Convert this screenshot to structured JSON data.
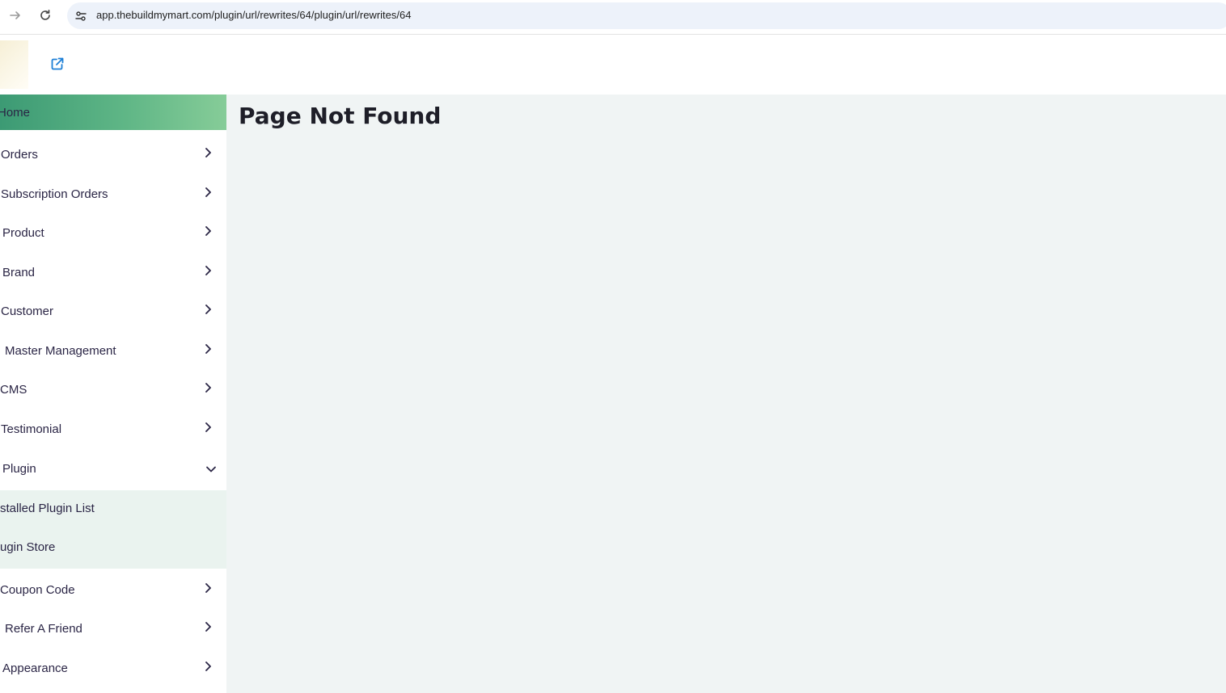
{
  "browser": {
    "url": "app.thebuildmymart.com/plugin/url/rewrites/64/plugin/url/rewrites/64"
  },
  "sidebar": {
    "items": [
      {
        "label": "Home",
        "active": true
      },
      {
        "label": "Orders"
      },
      {
        "label": "Subscription Orders"
      },
      {
        "label": "Product"
      },
      {
        "label": "Brand"
      },
      {
        "label": "Customer"
      },
      {
        "label": "Master Management"
      },
      {
        "label": "CMS"
      },
      {
        "label": "Testimonial"
      },
      {
        "label": "Plugin",
        "expanded": true
      },
      {
        "label": "Coupon Code"
      },
      {
        "label": "Refer A Friend"
      },
      {
        "label": "Appearance"
      }
    ],
    "plugin_submenu": [
      {
        "label": "stalled Plugin List"
      },
      {
        "label": "ugin Store"
      }
    ]
  },
  "main": {
    "title": "Page Not Found"
  },
  "colors": {
    "active_gradient_start": "#3c9a74",
    "active_gradient_end": "#86cc98",
    "submenu_bg": "#eaf3ef",
    "main_bg": "#f0f4f4",
    "link_blue": "#1c7fd6"
  }
}
